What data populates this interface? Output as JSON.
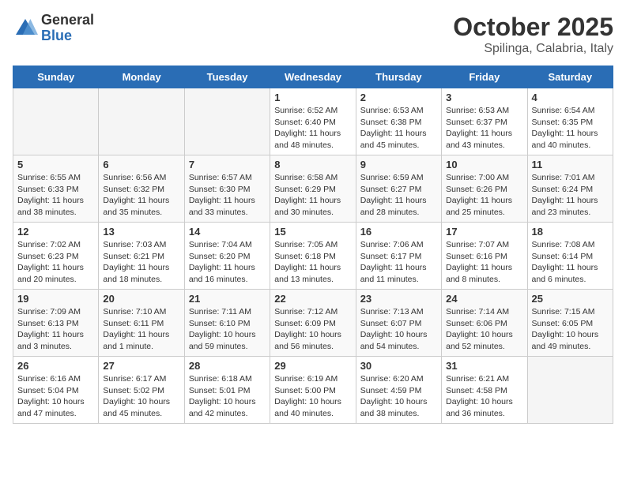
{
  "logo": {
    "general": "General",
    "blue": "Blue"
  },
  "title": "October 2025",
  "location": "Spilinga, Calabria, Italy",
  "days_header": [
    "Sunday",
    "Monday",
    "Tuesday",
    "Wednesday",
    "Thursday",
    "Friday",
    "Saturday"
  ],
  "weeks": [
    [
      {
        "day": "",
        "info": ""
      },
      {
        "day": "",
        "info": ""
      },
      {
        "day": "",
        "info": ""
      },
      {
        "day": "1",
        "info": "Sunrise: 6:52 AM\nSunset: 6:40 PM\nDaylight: 11 hours\nand 48 minutes."
      },
      {
        "day": "2",
        "info": "Sunrise: 6:53 AM\nSunset: 6:38 PM\nDaylight: 11 hours\nand 45 minutes."
      },
      {
        "day": "3",
        "info": "Sunrise: 6:53 AM\nSunset: 6:37 PM\nDaylight: 11 hours\nand 43 minutes."
      },
      {
        "day": "4",
        "info": "Sunrise: 6:54 AM\nSunset: 6:35 PM\nDaylight: 11 hours\nand 40 minutes."
      }
    ],
    [
      {
        "day": "5",
        "info": "Sunrise: 6:55 AM\nSunset: 6:33 PM\nDaylight: 11 hours\nand 38 minutes."
      },
      {
        "day": "6",
        "info": "Sunrise: 6:56 AM\nSunset: 6:32 PM\nDaylight: 11 hours\nand 35 minutes."
      },
      {
        "day": "7",
        "info": "Sunrise: 6:57 AM\nSunset: 6:30 PM\nDaylight: 11 hours\nand 33 minutes."
      },
      {
        "day": "8",
        "info": "Sunrise: 6:58 AM\nSunset: 6:29 PM\nDaylight: 11 hours\nand 30 minutes."
      },
      {
        "day": "9",
        "info": "Sunrise: 6:59 AM\nSunset: 6:27 PM\nDaylight: 11 hours\nand 28 minutes."
      },
      {
        "day": "10",
        "info": "Sunrise: 7:00 AM\nSunset: 6:26 PM\nDaylight: 11 hours\nand 25 minutes."
      },
      {
        "day": "11",
        "info": "Sunrise: 7:01 AM\nSunset: 6:24 PM\nDaylight: 11 hours\nand 23 minutes."
      }
    ],
    [
      {
        "day": "12",
        "info": "Sunrise: 7:02 AM\nSunset: 6:23 PM\nDaylight: 11 hours\nand 20 minutes."
      },
      {
        "day": "13",
        "info": "Sunrise: 7:03 AM\nSunset: 6:21 PM\nDaylight: 11 hours\nand 18 minutes."
      },
      {
        "day": "14",
        "info": "Sunrise: 7:04 AM\nSunset: 6:20 PM\nDaylight: 11 hours\nand 16 minutes."
      },
      {
        "day": "15",
        "info": "Sunrise: 7:05 AM\nSunset: 6:18 PM\nDaylight: 11 hours\nand 13 minutes."
      },
      {
        "day": "16",
        "info": "Sunrise: 7:06 AM\nSunset: 6:17 PM\nDaylight: 11 hours\nand 11 minutes."
      },
      {
        "day": "17",
        "info": "Sunrise: 7:07 AM\nSunset: 6:16 PM\nDaylight: 11 hours\nand 8 minutes."
      },
      {
        "day": "18",
        "info": "Sunrise: 7:08 AM\nSunset: 6:14 PM\nDaylight: 11 hours\nand 6 minutes."
      }
    ],
    [
      {
        "day": "19",
        "info": "Sunrise: 7:09 AM\nSunset: 6:13 PM\nDaylight: 11 hours\nand 3 minutes."
      },
      {
        "day": "20",
        "info": "Sunrise: 7:10 AM\nSunset: 6:11 PM\nDaylight: 11 hours\nand 1 minute."
      },
      {
        "day": "21",
        "info": "Sunrise: 7:11 AM\nSunset: 6:10 PM\nDaylight: 10 hours\nand 59 minutes."
      },
      {
        "day": "22",
        "info": "Sunrise: 7:12 AM\nSunset: 6:09 PM\nDaylight: 10 hours\nand 56 minutes."
      },
      {
        "day": "23",
        "info": "Sunrise: 7:13 AM\nSunset: 6:07 PM\nDaylight: 10 hours\nand 54 minutes."
      },
      {
        "day": "24",
        "info": "Sunrise: 7:14 AM\nSunset: 6:06 PM\nDaylight: 10 hours\nand 52 minutes."
      },
      {
        "day": "25",
        "info": "Sunrise: 7:15 AM\nSunset: 6:05 PM\nDaylight: 10 hours\nand 49 minutes."
      }
    ],
    [
      {
        "day": "26",
        "info": "Sunrise: 6:16 AM\nSunset: 5:04 PM\nDaylight: 10 hours\nand 47 minutes."
      },
      {
        "day": "27",
        "info": "Sunrise: 6:17 AM\nSunset: 5:02 PM\nDaylight: 10 hours\nand 45 minutes."
      },
      {
        "day": "28",
        "info": "Sunrise: 6:18 AM\nSunset: 5:01 PM\nDaylight: 10 hours\nand 42 minutes."
      },
      {
        "day": "29",
        "info": "Sunrise: 6:19 AM\nSunset: 5:00 PM\nDaylight: 10 hours\nand 40 minutes."
      },
      {
        "day": "30",
        "info": "Sunrise: 6:20 AM\nSunset: 4:59 PM\nDaylight: 10 hours\nand 38 minutes."
      },
      {
        "day": "31",
        "info": "Sunrise: 6:21 AM\nSunset: 4:58 PM\nDaylight: 10 hours\nand 36 minutes."
      },
      {
        "day": "",
        "info": ""
      }
    ]
  ]
}
